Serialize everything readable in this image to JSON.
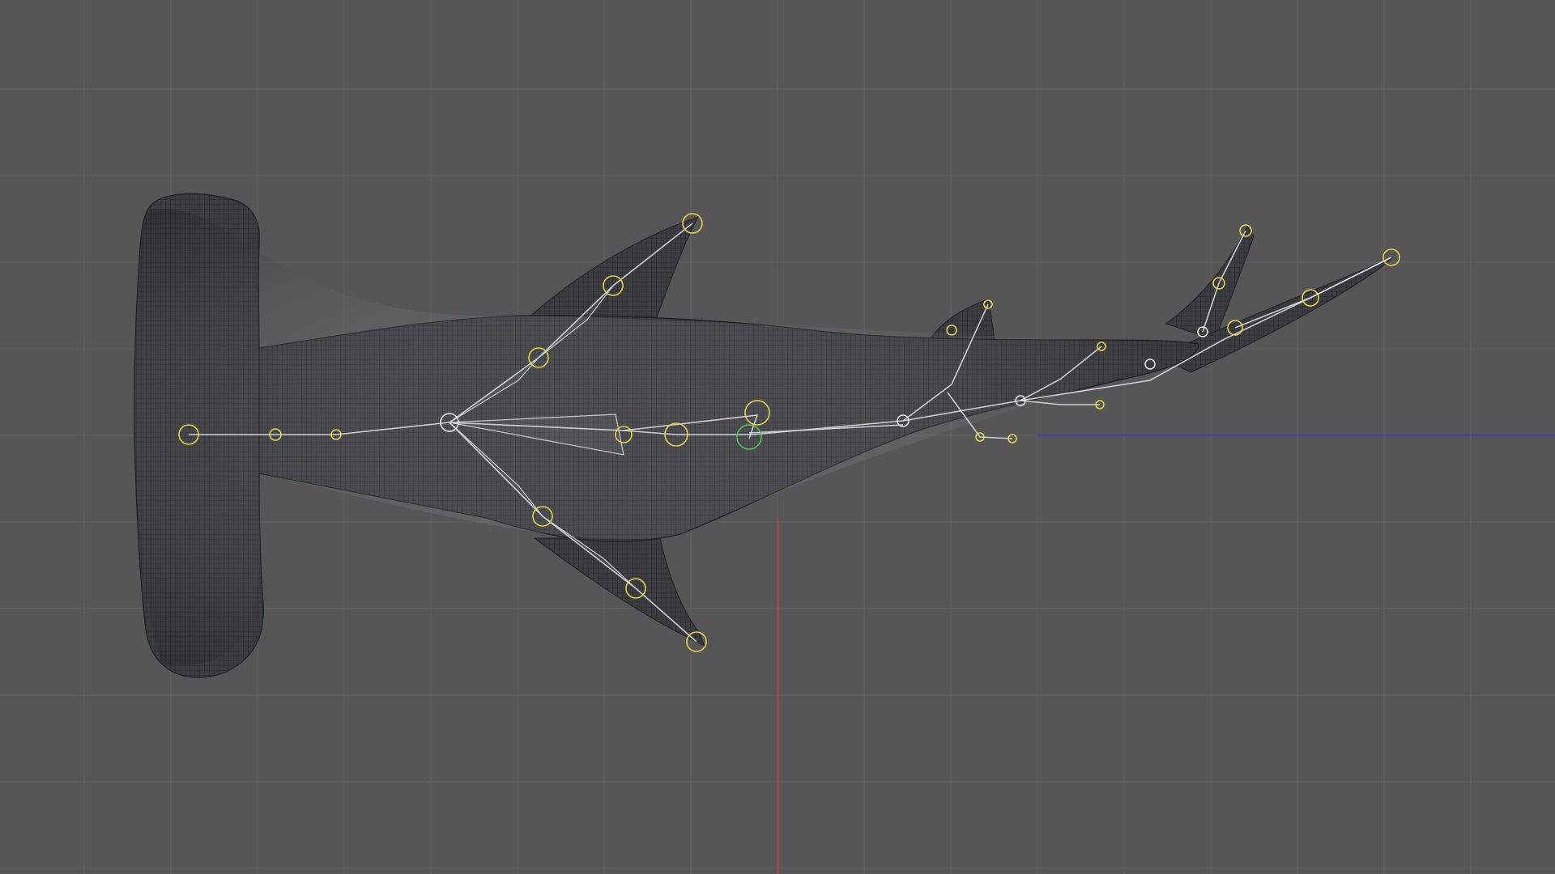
{
  "app": {
    "view": "3D viewport",
    "object": "hammerhead-shark-mesh-with-armature"
  },
  "scene": {
    "background_color": "#565656",
    "grid_color": "#616161",
    "mesh_color": "#3b3d40",
    "wire_color": "#202224",
    "bone_color": "#d9dde2",
    "joint_colors": {
      "head_tail": "#e6d34c",
      "selected_green": "#58c25a",
      "neutral": "#e8e8e8"
    },
    "axis_x_color": "#3a3ac8",
    "axis_y_color": "#d03a3a",
    "icons": {
      "joint": "circle-joint-icon",
      "bone": "bone-line"
    }
  }
}
